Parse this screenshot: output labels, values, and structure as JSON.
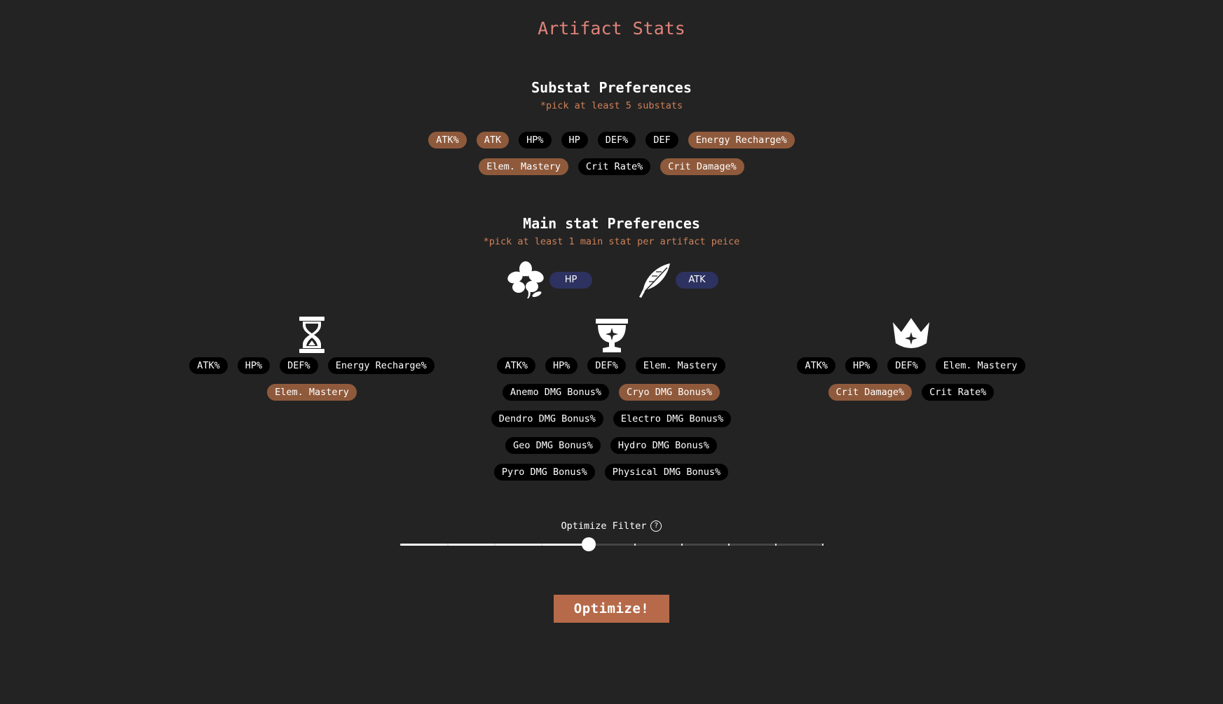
{
  "title": "Artifact Stats",
  "substats": {
    "heading": "Substat Preferences",
    "note": "*pick at least 5 substats",
    "row1": [
      {
        "label": "ATK%",
        "selected": true
      },
      {
        "label": "ATK",
        "selected": true
      },
      {
        "label": "HP%",
        "selected": false
      },
      {
        "label": "HP",
        "selected": false
      },
      {
        "label": "DEF%",
        "selected": false
      },
      {
        "label": "DEF",
        "selected": false
      },
      {
        "label": "Energy Recharge%",
        "selected": true
      }
    ],
    "row2": [
      {
        "label": "Elem. Mastery",
        "selected": true
      },
      {
        "label": "Crit Rate%",
        "selected": false
      },
      {
        "label": "Crit Damage%",
        "selected": true
      }
    ]
  },
  "mainstats": {
    "heading": "Main stat Preferences",
    "note": "*pick at least 1 main stat per artifact peice",
    "flower": {
      "icon": "flower-icon",
      "stat": "HP"
    },
    "plume": {
      "icon": "feather-icon",
      "stat": "ATK"
    },
    "sands": {
      "icon": "hourglass-icon",
      "rows": [
        [
          {
            "label": "ATK%",
            "selected": false
          },
          {
            "label": "HP%",
            "selected": false
          },
          {
            "label": "DEF%",
            "selected": false
          },
          {
            "label": "Energy Recharge%",
            "selected": false
          }
        ],
        [
          {
            "label": "Elem. Mastery",
            "selected": true
          }
        ]
      ]
    },
    "goblet": {
      "icon": "goblet-icon",
      "rows": [
        [
          {
            "label": "ATK%",
            "selected": false
          },
          {
            "label": "HP%",
            "selected": false
          },
          {
            "label": "DEF%",
            "selected": false
          },
          {
            "label": "Elem. Mastery",
            "selected": false
          }
        ],
        [
          {
            "label": "Anemo DMG Bonus%",
            "selected": false
          },
          {
            "label": "Cryo DMG Bonus%",
            "selected": true
          }
        ],
        [
          {
            "label": "Dendro DMG Bonus%",
            "selected": false
          },
          {
            "label": "Electro DMG Bonus%",
            "selected": false
          }
        ],
        [
          {
            "label": "Geo DMG Bonus%",
            "selected": false
          },
          {
            "label": "Hydro DMG Bonus%",
            "selected": false
          }
        ],
        [
          {
            "label": "Pyro DMG Bonus%",
            "selected": false
          },
          {
            "label": "Physical DMG Bonus%",
            "selected": false
          }
        ]
      ]
    },
    "circlet": {
      "icon": "crown-icon",
      "rows": [
        [
          {
            "label": "ATK%",
            "selected": false
          },
          {
            "label": "HP%",
            "selected": false
          },
          {
            "label": "DEF%",
            "selected": false
          },
          {
            "label": "Elem. Mastery",
            "selected": false
          }
        ],
        [
          {
            "label": "Crit Damage%",
            "selected": true
          },
          {
            "label": "Crit Rate%",
            "selected": false
          }
        ]
      ]
    }
  },
  "optimize_filter": {
    "label": "Optimize Filter",
    "help_icon": "question-mark-icon",
    "steps": 10,
    "value": 4
  },
  "optimize_button": "Optimize!",
  "colors": {
    "background": "#232323",
    "title": "#e0837a",
    "note": "#cf8159",
    "pill_selected": "#8f5a3c",
    "pill_unselected": "#000000",
    "pill_fixed": "#2d3260",
    "button": "#b66a4a"
  }
}
